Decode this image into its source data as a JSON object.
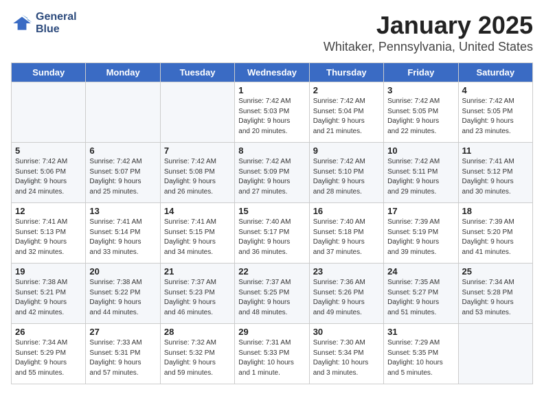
{
  "logo": {
    "line1": "General",
    "line2": "Blue"
  },
  "title": "January 2025",
  "location": "Whitaker, Pennsylvania, United States",
  "weekdays": [
    "Sunday",
    "Monday",
    "Tuesday",
    "Wednesday",
    "Thursday",
    "Friday",
    "Saturday"
  ],
  "weeks": [
    [
      {
        "day": "",
        "info": ""
      },
      {
        "day": "",
        "info": ""
      },
      {
        "day": "",
        "info": ""
      },
      {
        "day": "1",
        "info": "Sunrise: 7:42 AM\nSunset: 5:03 PM\nDaylight: 9 hours\nand 20 minutes."
      },
      {
        "day": "2",
        "info": "Sunrise: 7:42 AM\nSunset: 5:04 PM\nDaylight: 9 hours\nand 21 minutes."
      },
      {
        "day": "3",
        "info": "Sunrise: 7:42 AM\nSunset: 5:05 PM\nDaylight: 9 hours\nand 22 minutes."
      },
      {
        "day": "4",
        "info": "Sunrise: 7:42 AM\nSunset: 5:05 PM\nDaylight: 9 hours\nand 23 minutes."
      }
    ],
    [
      {
        "day": "5",
        "info": "Sunrise: 7:42 AM\nSunset: 5:06 PM\nDaylight: 9 hours\nand 24 minutes."
      },
      {
        "day": "6",
        "info": "Sunrise: 7:42 AM\nSunset: 5:07 PM\nDaylight: 9 hours\nand 25 minutes."
      },
      {
        "day": "7",
        "info": "Sunrise: 7:42 AM\nSunset: 5:08 PM\nDaylight: 9 hours\nand 26 minutes."
      },
      {
        "day": "8",
        "info": "Sunrise: 7:42 AM\nSunset: 5:09 PM\nDaylight: 9 hours\nand 27 minutes."
      },
      {
        "day": "9",
        "info": "Sunrise: 7:42 AM\nSunset: 5:10 PM\nDaylight: 9 hours\nand 28 minutes."
      },
      {
        "day": "10",
        "info": "Sunrise: 7:42 AM\nSunset: 5:11 PM\nDaylight: 9 hours\nand 29 minutes."
      },
      {
        "day": "11",
        "info": "Sunrise: 7:41 AM\nSunset: 5:12 PM\nDaylight: 9 hours\nand 30 minutes."
      }
    ],
    [
      {
        "day": "12",
        "info": "Sunrise: 7:41 AM\nSunset: 5:13 PM\nDaylight: 9 hours\nand 32 minutes."
      },
      {
        "day": "13",
        "info": "Sunrise: 7:41 AM\nSunset: 5:14 PM\nDaylight: 9 hours\nand 33 minutes."
      },
      {
        "day": "14",
        "info": "Sunrise: 7:41 AM\nSunset: 5:15 PM\nDaylight: 9 hours\nand 34 minutes."
      },
      {
        "day": "15",
        "info": "Sunrise: 7:40 AM\nSunset: 5:17 PM\nDaylight: 9 hours\nand 36 minutes."
      },
      {
        "day": "16",
        "info": "Sunrise: 7:40 AM\nSunset: 5:18 PM\nDaylight: 9 hours\nand 37 minutes."
      },
      {
        "day": "17",
        "info": "Sunrise: 7:39 AM\nSunset: 5:19 PM\nDaylight: 9 hours\nand 39 minutes."
      },
      {
        "day": "18",
        "info": "Sunrise: 7:39 AM\nSunset: 5:20 PM\nDaylight: 9 hours\nand 41 minutes."
      }
    ],
    [
      {
        "day": "19",
        "info": "Sunrise: 7:38 AM\nSunset: 5:21 PM\nDaylight: 9 hours\nand 42 minutes."
      },
      {
        "day": "20",
        "info": "Sunrise: 7:38 AM\nSunset: 5:22 PM\nDaylight: 9 hours\nand 44 minutes."
      },
      {
        "day": "21",
        "info": "Sunrise: 7:37 AM\nSunset: 5:23 PM\nDaylight: 9 hours\nand 46 minutes."
      },
      {
        "day": "22",
        "info": "Sunrise: 7:37 AM\nSunset: 5:25 PM\nDaylight: 9 hours\nand 48 minutes."
      },
      {
        "day": "23",
        "info": "Sunrise: 7:36 AM\nSunset: 5:26 PM\nDaylight: 9 hours\nand 49 minutes."
      },
      {
        "day": "24",
        "info": "Sunrise: 7:35 AM\nSunset: 5:27 PM\nDaylight: 9 hours\nand 51 minutes."
      },
      {
        "day": "25",
        "info": "Sunrise: 7:34 AM\nSunset: 5:28 PM\nDaylight: 9 hours\nand 53 minutes."
      }
    ],
    [
      {
        "day": "26",
        "info": "Sunrise: 7:34 AM\nSunset: 5:29 PM\nDaylight: 9 hours\nand 55 minutes."
      },
      {
        "day": "27",
        "info": "Sunrise: 7:33 AM\nSunset: 5:31 PM\nDaylight: 9 hours\nand 57 minutes."
      },
      {
        "day": "28",
        "info": "Sunrise: 7:32 AM\nSunset: 5:32 PM\nDaylight: 9 hours\nand 59 minutes."
      },
      {
        "day": "29",
        "info": "Sunrise: 7:31 AM\nSunset: 5:33 PM\nDaylight: 10 hours\nand 1 minute."
      },
      {
        "day": "30",
        "info": "Sunrise: 7:30 AM\nSunset: 5:34 PM\nDaylight: 10 hours\nand 3 minutes."
      },
      {
        "day": "31",
        "info": "Sunrise: 7:29 AM\nSunset: 5:35 PM\nDaylight: 10 hours\nand 5 minutes."
      },
      {
        "day": "",
        "info": ""
      }
    ]
  ]
}
